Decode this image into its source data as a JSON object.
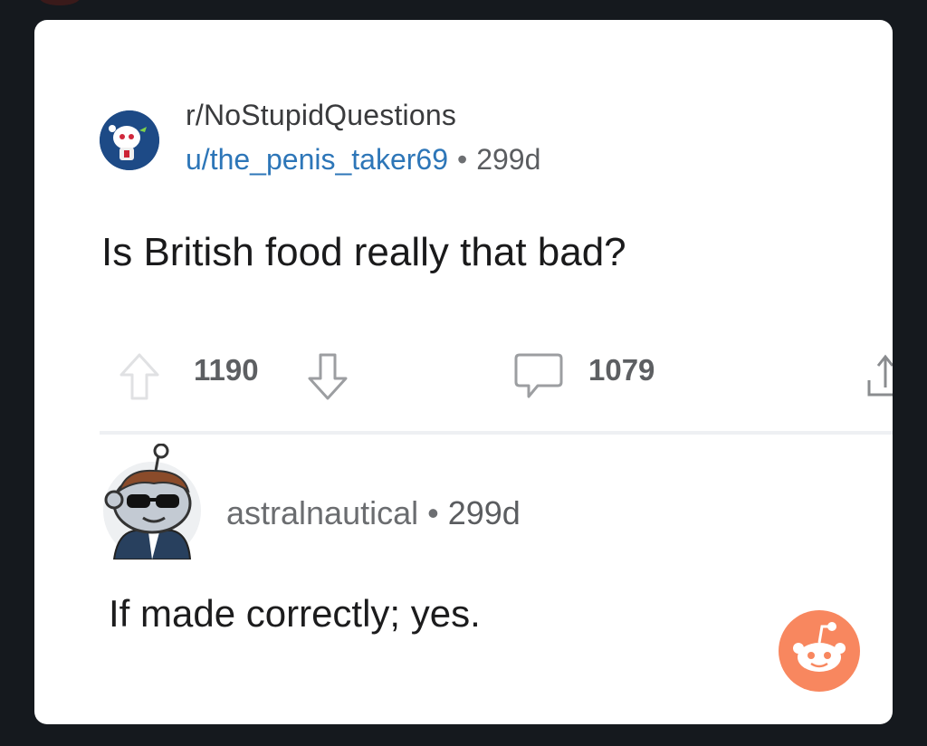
{
  "post": {
    "subreddit": "r/NoStupidQuestions",
    "author": "u/the_penis_taker69",
    "separator": "•",
    "age": "299d",
    "title": "Is British food really that bad?",
    "upvotes": "1190",
    "comments": "1079"
  },
  "comment": {
    "author": "astralnautical",
    "separator": "•",
    "age": "299d",
    "body": "If made correctly; yes."
  },
  "colors": {
    "link_blue": "#2d76b8",
    "reddit_orange": "#f8875f",
    "background_dark": "#15191e"
  },
  "icons": {
    "upvote": "arrow-up-icon",
    "downvote": "arrow-down-icon",
    "comment": "speech-bubble-icon",
    "share": "share-icon",
    "brand": "reddit-snoo-logo"
  }
}
